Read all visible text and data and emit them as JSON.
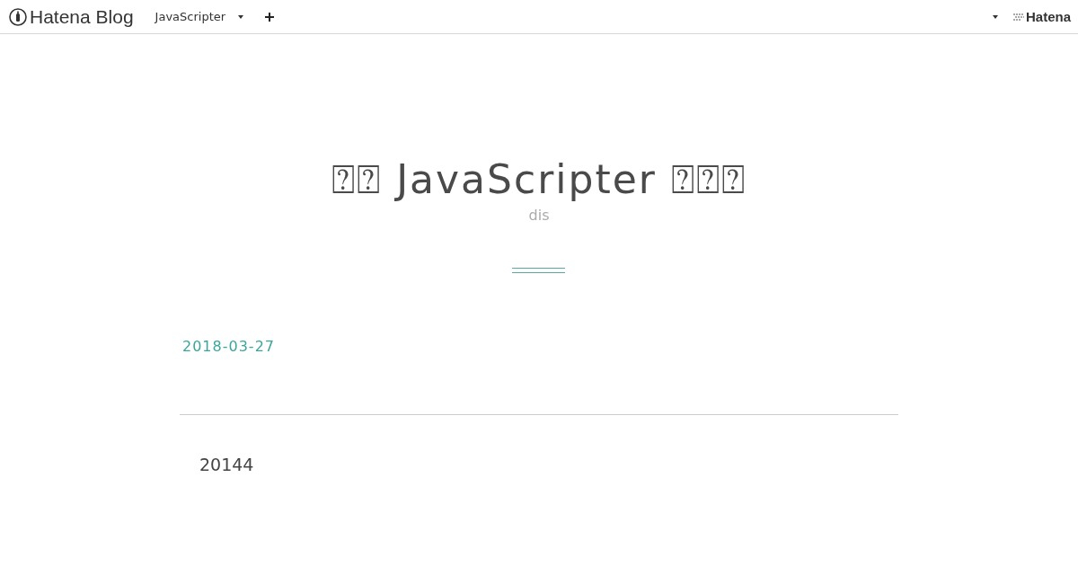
{
  "top_bar": {
    "logo": "Hatena Blog",
    "blog_menu": "JavaScripter",
    "right_logo": "Hatena"
  },
  "header": {
    "title": "⍰⍰ JavaScripter ⍰⍰⍰",
    "description": "dis"
  },
  "entry": {
    "date": "2018-03-27",
    "body": "20144"
  }
}
